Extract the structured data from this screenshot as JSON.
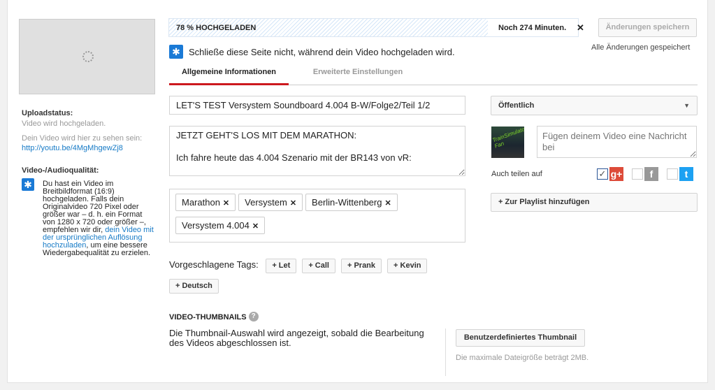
{
  "sidebar": {
    "upload_status_label": "Uploadstatus:",
    "upload_status_text": "Video wird hochgeladen.",
    "video_location_text": "Dein Video wird hier zu sehen sein:",
    "video_url": "http://youtu.be/4MgMhgewZj8",
    "quality_label": "Video-/Audioqualität:",
    "quality_text_1": "Du hast ein Video im Breitbildformat (16:9) hochgeladen. Falls dein Originalvideo 720 Pixel oder größer war – d. h. ein Format von 1280 x 720 oder größer –, empfehlen wir dir, ",
    "quality_link": "dein Video mit der ursprünglichen Auflösung hochzuladen",
    "quality_text_2": ", um eine bessere Wiedergabequalität zu erzielen."
  },
  "upload": {
    "progress_label": "78 % HOCHGELADEN",
    "progress_percent": 78,
    "remaining": "Noch 274 Minuten.",
    "cancel_icon": "close-icon",
    "save_button": "Änderungen speichern",
    "saved_status": "Alle Änderungen gespeichert",
    "warning": "Schließe diese Seite nicht, während dein Video hochgeladen wird."
  },
  "tabs": [
    {
      "label": "Allgemeine Informationen",
      "active": true
    },
    {
      "label": "Erweiterte Einstellungen",
      "active": false
    }
  ],
  "form": {
    "title_value": "LET'S TEST Versystem Soundboard 4.004 B-W/Folge2/Teil 1/2",
    "description_value": "JETZT GEHT'S LOS MIT DEM MARATHON:\n\nIch fahre heute das 4.004 Szenario mit der BR143 von vR:\n\nStrecke Berlin-Wittenberg(Aerosoft):",
    "tags": [
      "Marathon",
      "Versystem",
      "Berlin-Wittenberg",
      "Versystem 4.004"
    ],
    "suggested_label": "Vorgeschlagene Tags:",
    "suggested_tags": [
      "+ Let",
      "+ Call",
      "+ Prank",
      "+ Kevin",
      "+ Deutsch"
    ]
  },
  "right": {
    "privacy": "Öffentlich",
    "message_placeholder": "Fügen deinem Video eine Nachricht bei",
    "share_label": "Auch teilen auf",
    "share": [
      {
        "network": "Google+",
        "checked": true,
        "color": "#dd4b39",
        "glyph": "g+"
      },
      {
        "network": "Facebook",
        "checked": false,
        "color": "#999999",
        "glyph": "f"
      },
      {
        "network": "Twitter",
        "checked": false,
        "color": "#1da1f2",
        "glyph": "t"
      }
    ],
    "playlist_button": "+ Zur Playlist hinzufügen",
    "avatar_text": "TrainSimulator Fan"
  },
  "thumbnails": {
    "heading": "VIDEO-THUMBNAILS",
    "info": "Die Thumbnail-Auswahl wird angezeigt, sobald die Bearbeitung des Videos abgeschlossen ist.",
    "custom_button": "Benutzerdefiniertes Thumbnail",
    "max_size": "Die maximale Dateigröße beträgt 2MB."
  }
}
